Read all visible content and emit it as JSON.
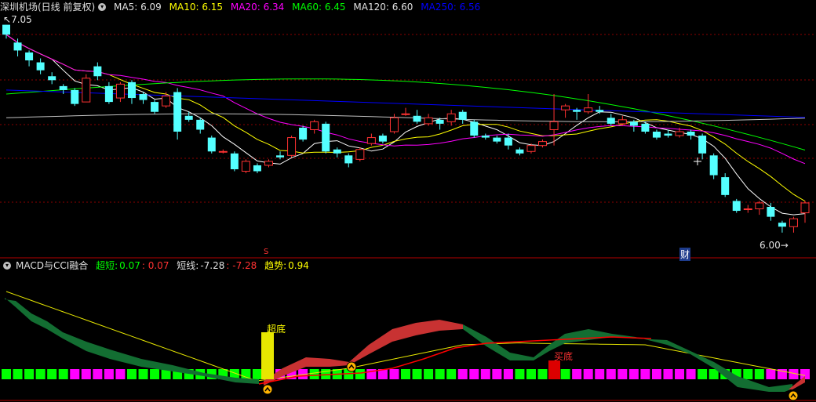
{
  "header": {
    "title": "深圳机场(日线 前复权)",
    "ma5": "MA5: 6.09",
    "ma10": "MA10: 6.15",
    "ma20": "MA20: 6.34",
    "ma60": "MA60: 6.45",
    "ma120": "MA120: 6.60",
    "ma250": "MA250: 6.56"
  },
  "indicator": {
    "name": "MACD与CCI融合",
    "chaoduan_label": "超短:",
    "chaoduan_v1": "0.07",
    "chaoduan_v2": ": 0.07",
    "duanxian_label": "短线:",
    "duanxian_v1": "-7.28",
    "duanxian_v2": ": -7.28",
    "qushi_label": "趋势:",
    "qushi_v": "0.94"
  },
  "annotations": {
    "max_price": "7.05",
    "min_price": "6.00",
    "cai_label": "财",
    "s_label": "S",
    "chaodi_label": "超底",
    "maidi_label": "买底"
  },
  "chart_data": {
    "type": "candlestick",
    "ylim": [
      5.94,
      7.08
    ],
    "colors": {
      "up": "#ff3232",
      "down": "#54ffff",
      "ma5": "#ffffff",
      "ma10": "#ffff00",
      "ma20": "#ff00ff",
      "ma60": "#00ff00",
      "ma120": "#c0c0c0",
      "ma250": "#0000ff"
    },
    "candles": [
      [
        7.05,
        7.0,
        7.05,
        6.98
      ],
      [
        6.96,
        6.92,
        6.98,
        6.89
      ],
      [
        6.91,
        6.87,
        6.92,
        6.84
      ],
      [
        6.86,
        6.82,
        6.88,
        6.8
      ],
      [
        6.79,
        6.77,
        6.81,
        6.75
      ],
      [
        6.74,
        6.72,
        6.75,
        6.7
      ],
      [
        6.72,
        6.65,
        6.73,
        6.64
      ],
      [
        6.66,
        6.78,
        6.8,
        6.66
      ],
      [
        6.84,
        6.79,
        6.86,
        6.77
      ],
      [
        6.74,
        6.66,
        6.76,
        6.65
      ],
      [
        6.68,
        6.75,
        6.76,
        6.66
      ],
      [
        6.76,
        6.68,
        6.77,
        6.65
      ],
      [
        6.7,
        6.67,
        6.71,
        6.65
      ],
      [
        6.66,
        6.61,
        6.67,
        6.6
      ],
      [
        6.64,
        6.69,
        6.71,
        6.63
      ],
      [
        6.71,
        6.51,
        6.73,
        6.47
      ],
      [
        6.59,
        6.57,
        6.61,
        6.56
      ],
      [
        6.57,
        6.52,
        6.58,
        6.5
      ],
      [
        6.48,
        6.41,
        6.49,
        6.4
      ],
      [
        6.41,
        6.41,
        6.42,
        6.4
      ],
      [
        6.4,
        6.32,
        6.41,
        6.31
      ],
      [
        6.31,
        6.36,
        6.37,
        6.3
      ],
      [
        6.34,
        6.31,
        6.35,
        6.3
      ],
      [
        6.34,
        6.36,
        6.37,
        6.33
      ],
      [
        6.39,
        6.38,
        6.41,
        6.37
      ],
      [
        6.39,
        6.48,
        6.49,
        6.38
      ],
      [
        6.53,
        6.47,
        6.54,
        6.46
      ],
      [
        6.52,
        6.56,
        6.57,
        6.5
      ],
      [
        6.55,
        6.41,
        6.56,
        6.4
      ],
      [
        6.42,
        6.4,
        6.43,
        6.38
      ],
      [
        6.39,
        6.35,
        6.4,
        6.33
      ],
      [
        6.37,
        6.42,
        6.43,
        6.36
      ],
      [
        6.45,
        6.48,
        6.5,
        6.44
      ],
      [
        6.49,
        6.46,
        6.5,
        6.45
      ],
      [
        6.51,
        6.58,
        6.6,
        6.5
      ],
      [
        6.6,
        6.6,
        6.63,
        6.59
      ],
      [
        6.59,
        6.56,
        6.62,
        6.55
      ],
      [
        6.55,
        6.58,
        6.6,
        6.54
      ],
      [
        6.57,
        6.55,
        6.58,
        6.52
      ],
      [
        6.56,
        6.6,
        6.62,
        6.54
      ],
      [
        6.61,
        6.57,
        6.62,
        6.55
      ],
      [
        6.56,
        6.49,
        6.57,
        6.48
      ],
      [
        6.49,
        6.48,
        6.5,
        6.47
      ],
      [
        6.48,
        6.46,
        6.49,
        6.45
      ],
      [
        6.48,
        6.44,
        6.5,
        6.42
      ],
      [
        6.42,
        6.4,
        6.43,
        6.39
      ],
      [
        6.41,
        6.44,
        6.45,
        6.4
      ],
      [
        6.44,
        6.46,
        6.47,
        6.43
      ],
      [
        6.52,
        6.56,
        6.7,
        6.44
      ],
      [
        6.62,
        6.64,
        6.65,
        6.58
      ],
      [
        6.62,
        6.61,
        6.63,
        6.57
      ],
      [
        6.61,
        6.63,
        6.7,
        6.6
      ],
      [
        6.62,
        6.61,
        6.64,
        6.6
      ],
      [
        6.58,
        6.55,
        6.6,
        6.54
      ],
      [
        6.55,
        6.57,
        6.59,
        6.54
      ],
      [
        6.56,
        6.54,
        6.57,
        6.51
      ],
      [
        6.55,
        6.51,
        6.56,
        6.5
      ],
      [
        6.51,
        6.48,
        6.52,
        6.47
      ],
      [
        6.5,
        6.49,
        6.52,
        6.48
      ],
      [
        6.49,
        6.51,
        6.53,
        6.48
      ],
      [
        6.51,
        6.49,
        6.52,
        6.47
      ],
      [
        6.49,
        6.4,
        6.5,
        6.37
      ],
      [
        6.39,
        6.29,
        6.4,
        6.27
      ],
      [
        6.28,
        6.19,
        6.3,
        6.18
      ],
      [
        6.16,
        6.11,
        6.17,
        6.1
      ],
      [
        6.12,
        6.12,
        6.14,
        6.1
      ],
      [
        6.12,
        6.15,
        6.16,
        6.09
      ],
      [
        6.13,
        6.08,
        6.15,
        6.06
      ],
      [
        6.05,
        6.03,
        6.06,
        6.0
      ],
      [
        6.03,
        6.07,
        6.08,
        6.0
      ],
      [
        6.1,
        6.15,
        6.16,
        6.05
      ]
    ]
  }
}
